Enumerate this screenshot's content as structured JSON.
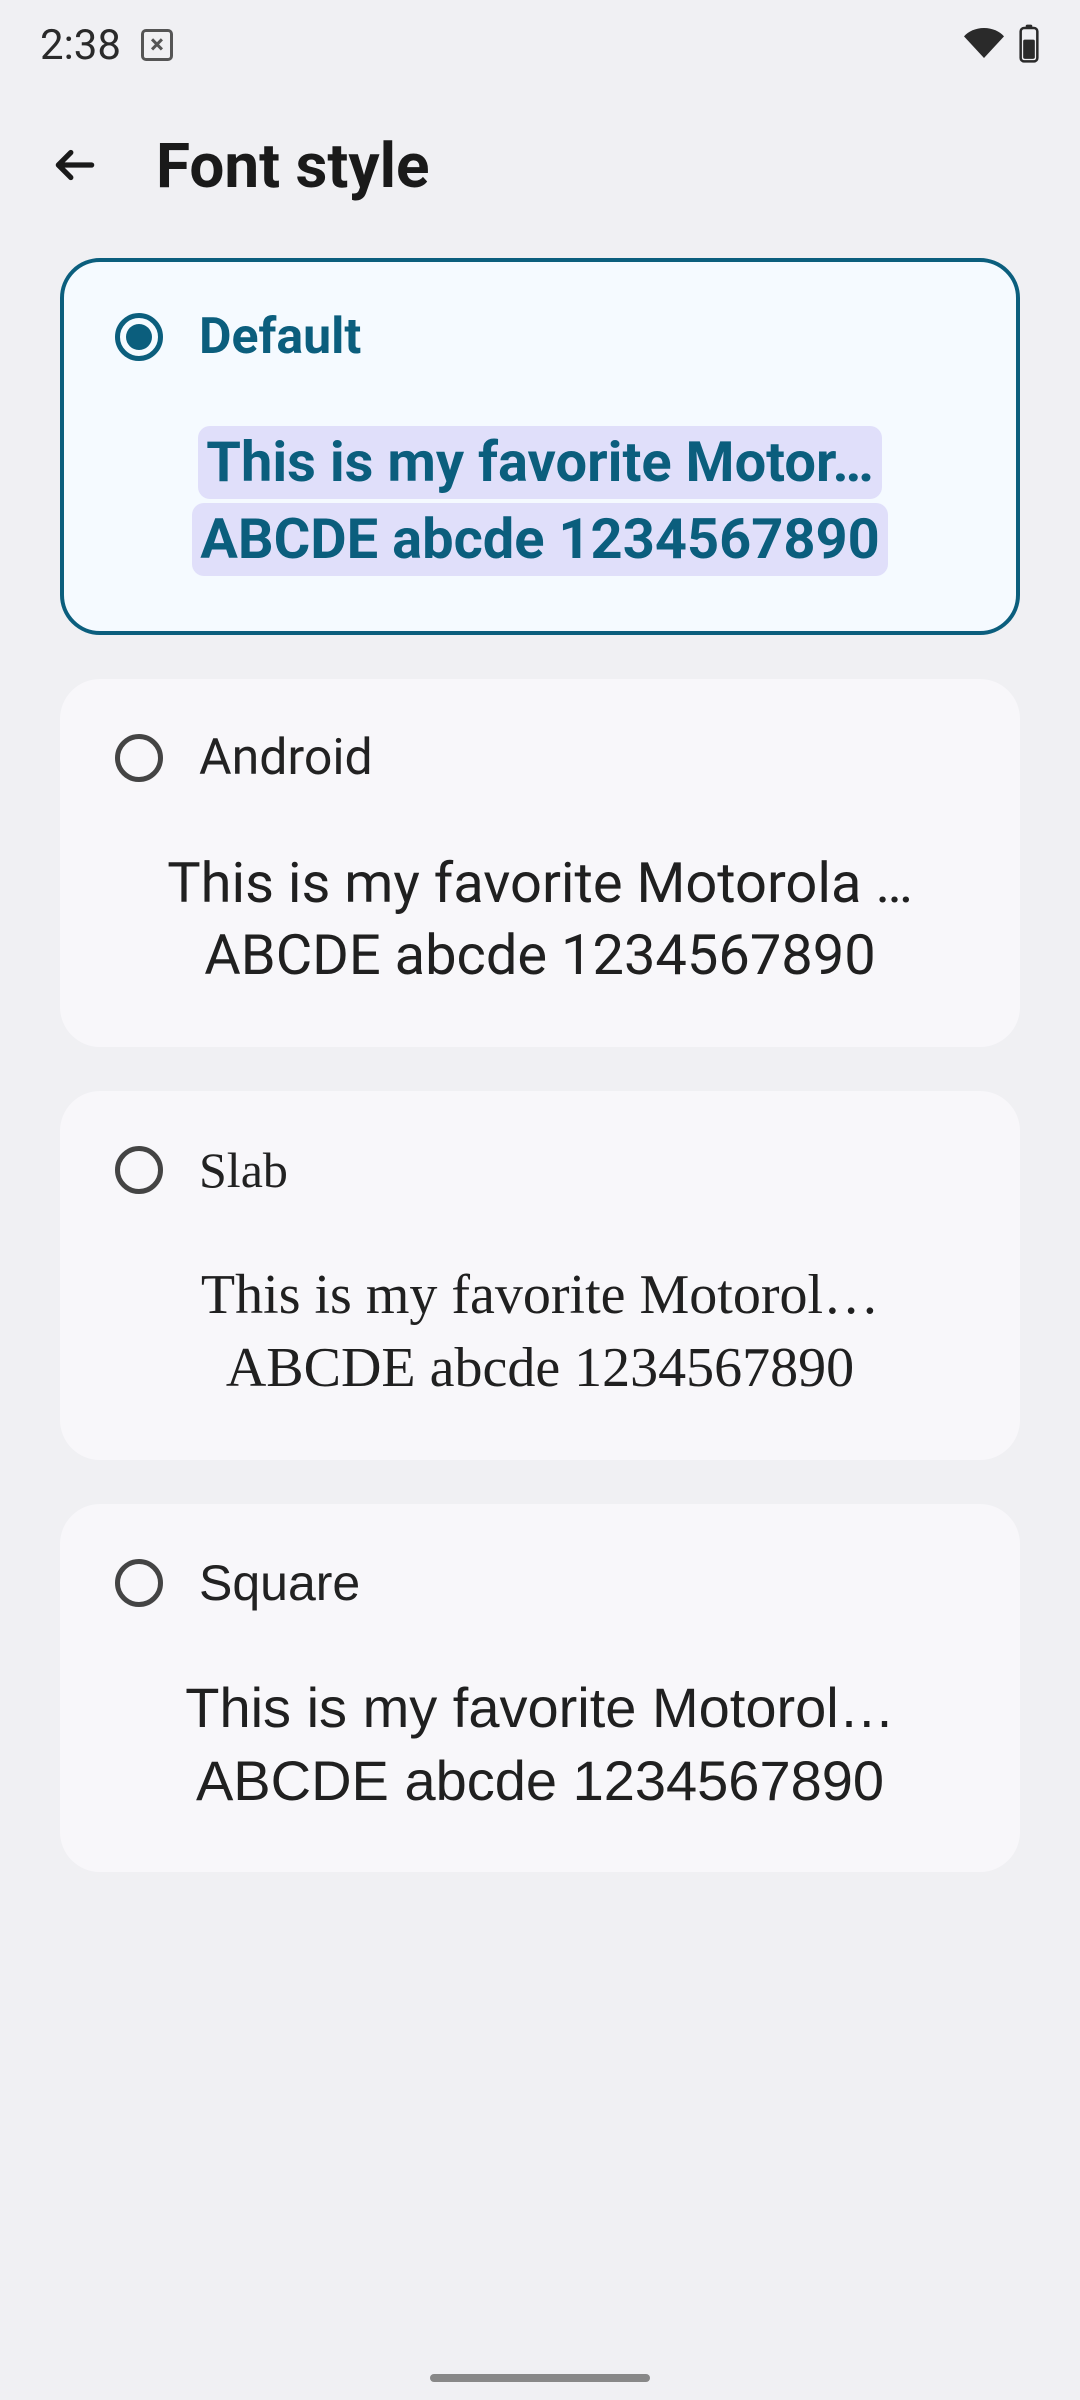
{
  "status": {
    "time": "2:38"
  },
  "header": {
    "title": "Font style"
  },
  "options": [
    {
      "name": "Default",
      "selected": true,
      "font_class": "font-default",
      "preview_line1": "This is my favorite Motor…",
      "preview_line2": "ABCDE abcde 1234567890"
    },
    {
      "name": "Android",
      "selected": false,
      "font_class": "font-android",
      "preview_line1": "This is my favorite Motorola …",
      "preview_line2": "ABCDE abcde 1234567890"
    },
    {
      "name": "Slab",
      "selected": false,
      "font_class": "font-slab",
      "preview_line1": "This is my favorite Motorol…",
      "preview_line2": "ABCDE abcde 1234567890"
    },
    {
      "name": "Square",
      "selected": false,
      "font_class": "font-square",
      "preview_line1": "This is my favorite Motorol…",
      "preview_line2": "ABCDE abcde 1234567890"
    }
  ]
}
